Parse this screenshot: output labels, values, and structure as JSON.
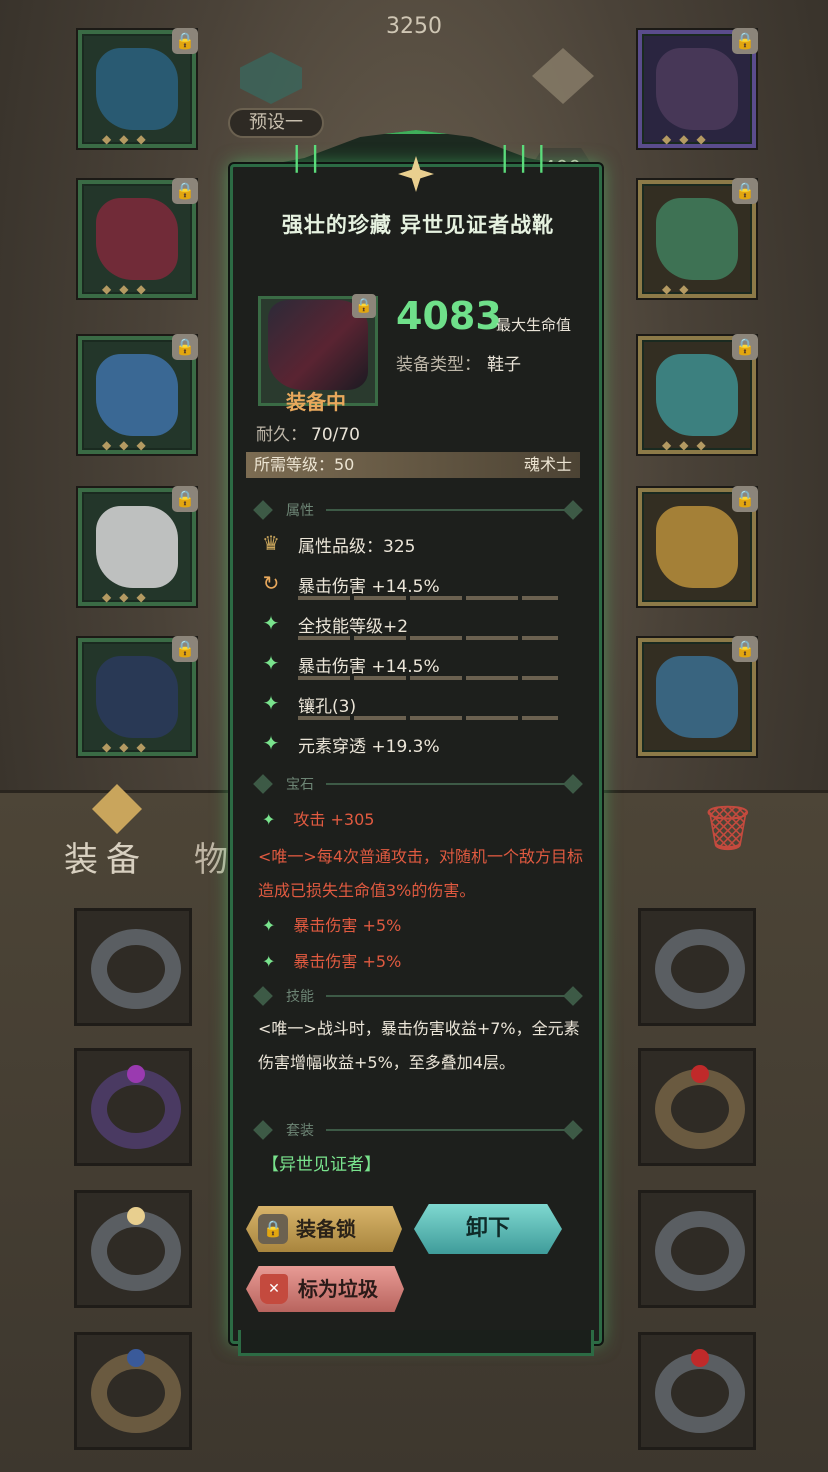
{
  "header": {
    "power": "3250",
    "preset_label": "预设一",
    "points": "400"
  },
  "left_slots": [
    {
      "name": "weapon-slot",
      "color": "#2a5e7a"
    },
    {
      "name": "armor-slot",
      "color": "#7a2a3a"
    },
    {
      "name": "shoulder-slot",
      "color": "#3d6ea0"
    },
    {
      "name": "pants-slot",
      "color": "#cfcfcf"
    },
    {
      "name": "boots-slot",
      "color": "#2a3a5a"
    }
  ],
  "right_slots": [
    {
      "name": "amulet-slot",
      "color": "#4a3a5a"
    },
    {
      "name": "ring-slot-1",
      "color": "#3f7a5a"
    },
    {
      "name": "ring-slot-2",
      "color": "#3d8a8a"
    },
    {
      "name": "staff-slot",
      "color": "#b08a3a"
    },
    {
      "name": "offhand-slot",
      "color": "#3a6a8a"
    }
  ],
  "inventory": {
    "tab_equipment": "装备",
    "tab_items": "物",
    "rings": [
      {
        "color": "#5a5e62",
        "gem": ""
      },
      {
        "color": "#5a5e62",
        "gem": ""
      },
      {
        "color": "#4a3a62",
        "gem": "#9a3ab0"
      },
      {
        "color": "#6a5a40",
        "gem": "#c02a2a"
      },
      {
        "color": "#5a5e62",
        "gem": "#e8cf8f"
      },
      {
        "color": "#5a5e62",
        "gem": ""
      },
      {
        "color": "#6a5a40",
        "gem": "#3a5a9a"
      },
      {
        "color": "#5a5e62",
        "gem": "#c02a2a"
      }
    ]
  },
  "tooltip": {
    "title": "强壮的珍藏 异世见证者战靴",
    "equipped_label": "装备中",
    "main_value": "4083",
    "main_label": "最大生命值",
    "type_label": "装备类型：",
    "type_value": "鞋子",
    "durability_label": "耐久：",
    "durability_value": "70/70",
    "required_level": "所需等级：50",
    "class": "魂术士",
    "section_attr": "属性",
    "attributes": [
      {
        "icon": "quality-icon",
        "text": "属性品级：325",
        "bar": false
      },
      {
        "icon": "refresh-icon",
        "text": "暴击伤害 +14.5%",
        "bar": true
      },
      {
        "icon": "sparkle-icon",
        "text": "全技能等级+2",
        "bar": true
      },
      {
        "icon": "sparkle-icon",
        "text": "暴击伤害 +14.5%",
        "bar": true
      },
      {
        "icon": "sparkle-icon",
        "text": "镶孔(3)",
        "bar": true
      },
      {
        "icon": "sparkle-icon",
        "text": "元素穿透 +19.3%",
        "bar": true
      }
    ],
    "section_gem": "宝石",
    "gem_1": "攻击 +305",
    "gem_desc": "<唯一>每4次普通攻击，对随机一个敌方目标造成已损失生命值3%的伤害。",
    "gem_2": "暴击伤害 +5%",
    "gem_3": "暴击伤害 +5%",
    "section_skill": "技能",
    "skill_desc": "<唯一>战斗时，暴击伤害收益+7%，全元素伤害增幅收益+5%，至多叠加4层。",
    "section_set": "套装",
    "set_name": "【异世见证者】",
    "btn_lock": "装备锁",
    "btn_unequip": "卸下",
    "btn_trash": "标为垃圾"
  },
  "colors": {
    "rarity_green": "#6fe08a",
    "unique_red": "#e05a40",
    "equipped_orange": "#e8a85c"
  }
}
